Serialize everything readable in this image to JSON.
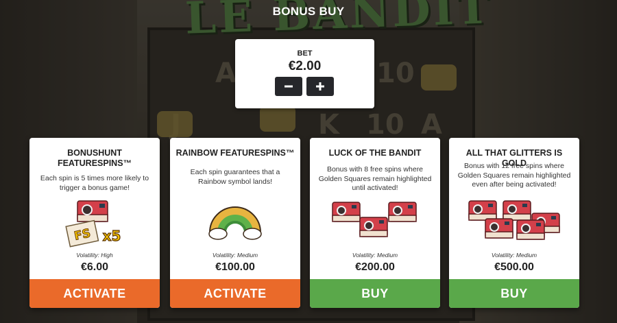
{
  "header": {
    "title": "BONUS BUY"
  },
  "bet": {
    "label": "BET",
    "value": "€2.00",
    "decrease_icon": "minus-icon",
    "increase_icon": "plus-icon"
  },
  "cards": [
    {
      "title": "BONUSHUNT FEATURESPINS™",
      "description": "Each spin is 5 times more likely to trigger a bonus game!",
      "art_icon": "camera-fs-x5-icon",
      "art_text_fs": "FS",
      "art_text_mult": "x5",
      "volatility": "Volatility: High",
      "price": "€6.00",
      "button_label": "ACTIVATE",
      "button_color": "#ea6a2a"
    },
    {
      "title": "RAINBOW FEATURESPINS™",
      "description": "Each spin guarantees that a Rainbow symbol lands!",
      "art_icon": "rainbow-icon",
      "volatility": "Volatility: Medium",
      "price": "€100.00",
      "button_label": "ACTIVATE",
      "button_color": "#ea6a2a"
    },
    {
      "title": "LUCK OF THE BANDIT",
      "description": "Bonus with 8 free spins where Golden Squares remain highlighted until activated!",
      "art_icon": "three-cameras-icon",
      "volatility": "Volatility: Medium",
      "price": "€200.00",
      "button_label": "BUY",
      "button_color": "#5aa84a"
    },
    {
      "title": "ALL THAT GLITTERS IS GOLD",
      "description": "Bonus with 12 free spins where Golden Squares remain highlighted even after being activated!",
      "art_icon": "four-cameras-icon",
      "volatility": "Volatility: Medium",
      "price": "€500.00",
      "button_label": "BUY",
      "button_color": "#5aa84a"
    }
  ],
  "background": {
    "logo_text": "LE BANDIT",
    "reel_symbols": [
      "A",
      "10",
      "J",
      "K",
      "10",
      "A"
    ]
  }
}
